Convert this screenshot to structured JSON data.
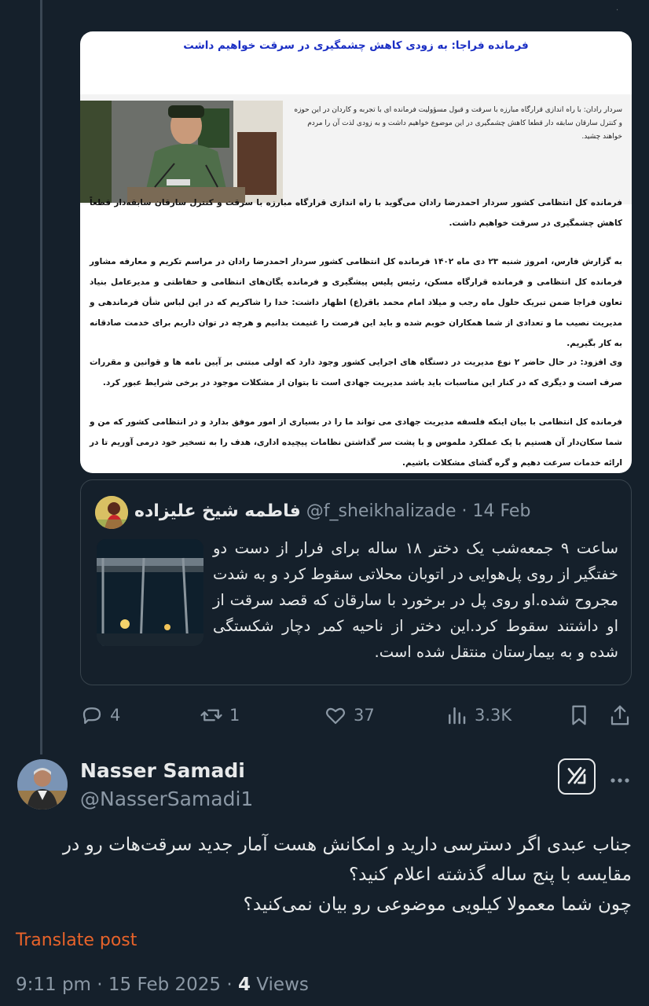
{
  "article": {
    "title": "فرمانده فراجا: به زودی کاهش چشمگیری در سرقت خواهیم داشت",
    "lead": "سردار رادان: با راه اندازی قرارگاه مبارزه با سرقت و قبول مسؤولیت فرمانده ای با تجربه و کاردان در این حوزه و کنترل سارقان سابقه دار قطعا کاهش چشمگیری در این موضوع خواهیم داشت و به زودی لذت آن را مردم خواهند چشید.",
    "paragraphs": [
      "فرمانده کل انتظامی کشور سردار احمدرضا رادان می‌گوید با راه اندازی قرارگاه مبارزه با سرقت و کنترل سارقان سابقه‌دار قطعاً کاهش چشمگیری در سرقت خواهیم داشت.",
      "به گزارش فارس، امروز شنبه ۲۳ دی ماه ۱۴۰۲ فرمانده کل انتظامی کشور سردار احمدرضا رادان در مراسم تکریم و معارفه مشاور فرمانده کل انتظامی و فرمانده قرارگاه مسکن، رئیس پلیس پیشگیری و فرمانده یگان‌های انتظامی و حفاظتی و مدیرعامل بنیاد تعاون فراجا ضمن تبریک حلول ماه رجب و میلاد امام محمد باقر(ع) اظهار داشت: خدا را شاکریم که در این لباس شأن فرماندهی و مدیریت نصیب ما و تعدادی از شما همکاران خوبم شده و باید این فرصت را غنیمت بدانیم و هرچه در توان داریم برای خدمت صادقانه به کار بگیریم.",
      "وی افزود: در حال حاضر ۲ نوع مدیریت در دستگاه های اجرایی کشور وجود دارد که اولی مبتنی بر آیین نامه ها و قوانین و مقررات صرف است و دیگری که در کنار این مناسبات باید باشد مدیریت جهادی است تا بتوان از مشکلات موجود در برخی شرایط عبور کرد.",
      "فرمانده کل انتظامی با بیان اینکه فلسفه مدیریت جهادی می تواند ما را در بسیاری از امور موفق بدارد و در انتظامی کشور که من و شما سکان‌دار آن هستیم با یک عملکرد ملموس و با پشت سر گذاشتن نظامات پیچیده اداری، هدف را به تسخیر خود درمی آوریم تا در ارائه خدمات سرعت دهیم و گره گشای مشکلات باشیم."
    ]
  },
  "quote": {
    "name": "فاطمه شیخ علیزاده",
    "handle": "@f_sheikhalizade",
    "date": "· 14 Feb",
    "text": "ساعت ۹ جمعه‌شب یک دختر ۱۸ ساله برای فرار از دست دو خفتگیر از روی پل‌هوایی در اتوبان محلاتی سقوط کرد و به شدت مجروح شده.او روی پل در برخورد با سارقان که قصد سرقت از او داشتند سقوط کرد.این دختر از ناحیه کمر دچار شکستگی شده و به بیمارستان منتقل شده است."
  },
  "actions": {
    "replies": "4",
    "reposts": "1",
    "likes": "37",
    "views": "3.3K"
  },
  "reply": {
    "name": "Nasser Samadi",
    "handle": "@NasserSamadi1",
    "line1": "جناب عبدی اگر دسترسی دارید و امکانش هست آمار جدید سرقت‌هات رو در مقایسه با پنج ساله گذشته اعلام کنید؟",
    "line2": "چون شما معمولا کیلویی موضوعی رو بیان نمی‌کنید؟",
    "translate": "Translate post",
    "time": "9:11 pm · 15 Feb 2025 · ",
    "views_count": "4",
    "views_label": " Views"
  },
  "colors": {
    "background": "#15202b",
    "accent_translate": "#e8632a",
    "title_blue": "#1a2ec4",
    "muted": "#8b98a5"
  }
}
